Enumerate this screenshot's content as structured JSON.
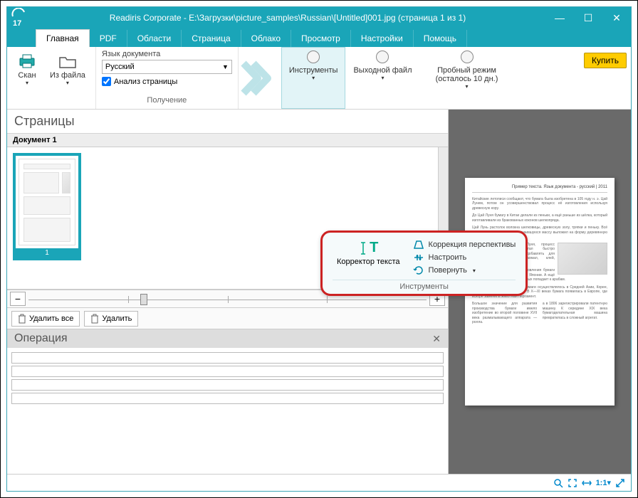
{
  "titlebar": {
    "app_version": "17",
    "title": "Readiris Corporate - E:\\Загрузки\\picture_samples\\Russian\\[Untitled]001.jpg (страница 1 из 1)"
  },
  "buy_button": "Купить",
  "tabs": [
    "Главная",
    "PDF",
    "Области",
    "Страница",
    "Облако",
    "Просмотр",
    "Настройки",
    "Помощь"
  ],
  "ribbon": {
    "scan": "Скан",
    "from_file": "Из файла",
    "lang_label": "Язык документа",
    "lang_value": "Русский",
    "analyze_page": "Анализ страницы",
    "group_acquire": "Получение",
    "tools": "Инструменты",
    "output": "Выходной файл",
    "trial": "Пробный режим (осталось 10 дн.)"
  },
  "dropdown": {
    "text_corrector": "Корректор текста",
    "perspective": "Коррекция перспективы",
    "adjust": "Настроить",
    "rotate": "Повернуть",
    "caption": "Инструменты"
  },
  "left": {
    "pages_title": "Страницы",
    "doc_name": "Документ 1",
    "thumb_label": "1",
    "delete_all": "Удалить все",
    "delete": "Удалить",
    "operation": "Операция"
  },
  "preview": {
    "title": "Пример текста. Язык документа - русский | 2011"
  },
  "status": {
    "ratio": "1:1"
  }
}
